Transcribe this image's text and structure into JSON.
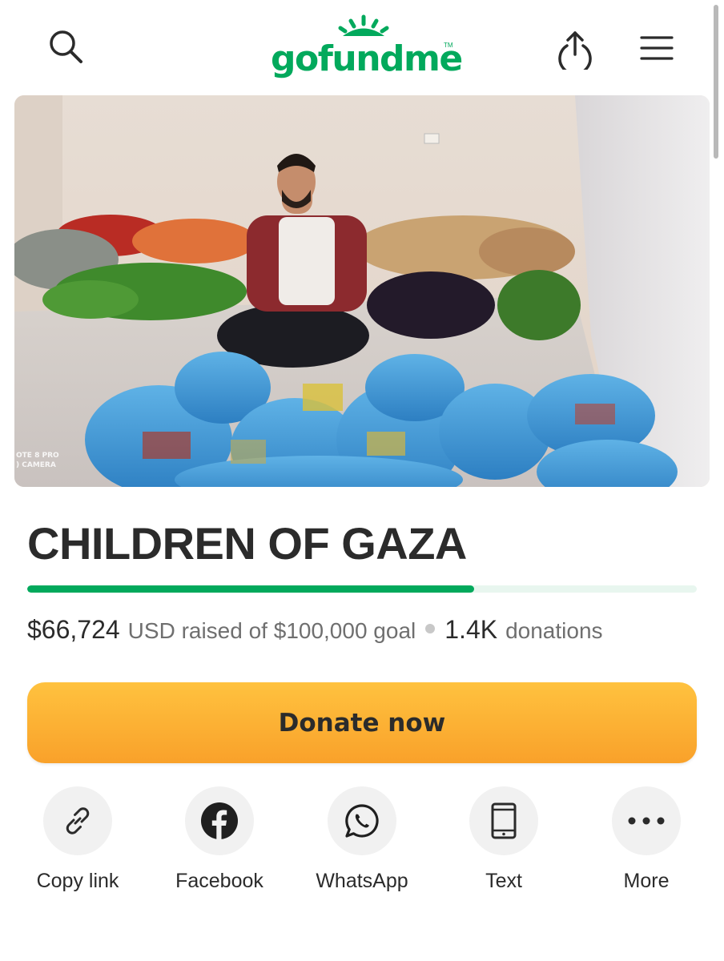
{
  "header": {
    "logo_text": "gofundme",
    "logo_tm": "TM",
    "brand_color": "#02a95c",
    "icons": {
      "search": "search-icon",
      "share": "share-upload-icon",
      "menu": "hamburger-menu-icon"
    }
  },
  "hero": {
    "watermark_line1": "OTE 8 PRO",
    "watermark_line2": ") CAMERA"
  },
  "campaign": {
    "title": "CHILDREN OF GAZA",
    "progress_fraction": 0.667,
    "raised_amount": "$66,724",
    "raised_text": "USD raised of $100,000 goal",
    "donations_count": "1.4K",
    "donations_label": "donations"
  },
  "donate_button": {
    "label": "Donate now",
    "color": "#fbb03b"
  },
  "share_options": [
    {
      "label": "Copy link",
      "icon": "link-icon"
    },
    {
      "label": "Facebook",
      "icon": "facebook-icon"
    },
    {
      "label": "WhatsApp",
      "icon": "whatsapp-icon"
    },
    {
      "label": "Text",
      "icon": "phone-icon"
    },
    {
      "label": "More",
      "icon": "more-dots-icon"
    }
  ]
}
